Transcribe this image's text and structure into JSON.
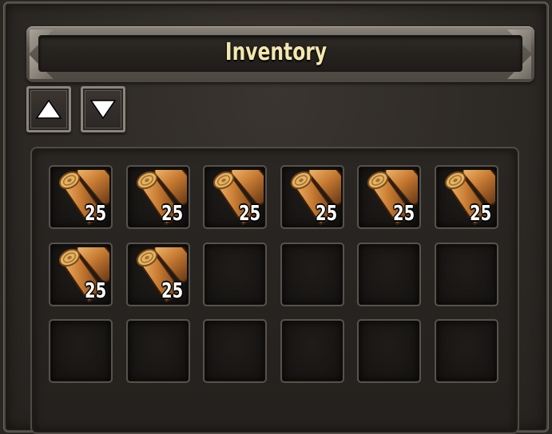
{
  "window": {
    "title": "Inventory"
  },
  "controls": {
    "scroll_up_icon": "triangle-up-icon",
    "scroll_down_icon": "triangle-down-icon"
  },
  "inventory": {
    "columns": 6,
    "slots": [
      {
        "item": "wood-log",
        "quantity": "25"
      },
      {
        "item": "wood-log",
        "quantity": "25"
      },
      {
        "item": "wood-log",
        "quantity": "25"
      },
      {
        "item": "wood-log",
        "quantity": "25"
      },
      {
        "item": "wood-log",
        "quantity": "25"
      },
      {
        "item": "wood-log",
        "quantity": "25"
      },
      {
        "item": "wood-log",
        "quantity": "25"
      },
      {
        "item": "wood-log",
        "quantity": "25"
      },
      {
        "item": null,
        "quantity": null
      },
      {
        "item": null,
        "quantity": null
      },
      {
        "item": null,
        "quantity": null
      },
      {
        "item": null,
        "quantity": null
      },
      {
        "item": null,
        "quantity": null
      },
      {
        "item": null,
        "quantity": null
      },
      {
        "item": null,
        "quantity": null
      },
      {
        "item": null,
        "quantity": null
      },
      {
        "item": null,
        "quantity": null
      },
      {
        "item": null,
        "quantity": null
      }
    ]
  },
  "colors": {
    "title_text": "#f3e7b0",
    "quantity_text": "#ffffff",
    "log_bark": "#c77a32",
    "log_end": "#e2b464"
  }
}
